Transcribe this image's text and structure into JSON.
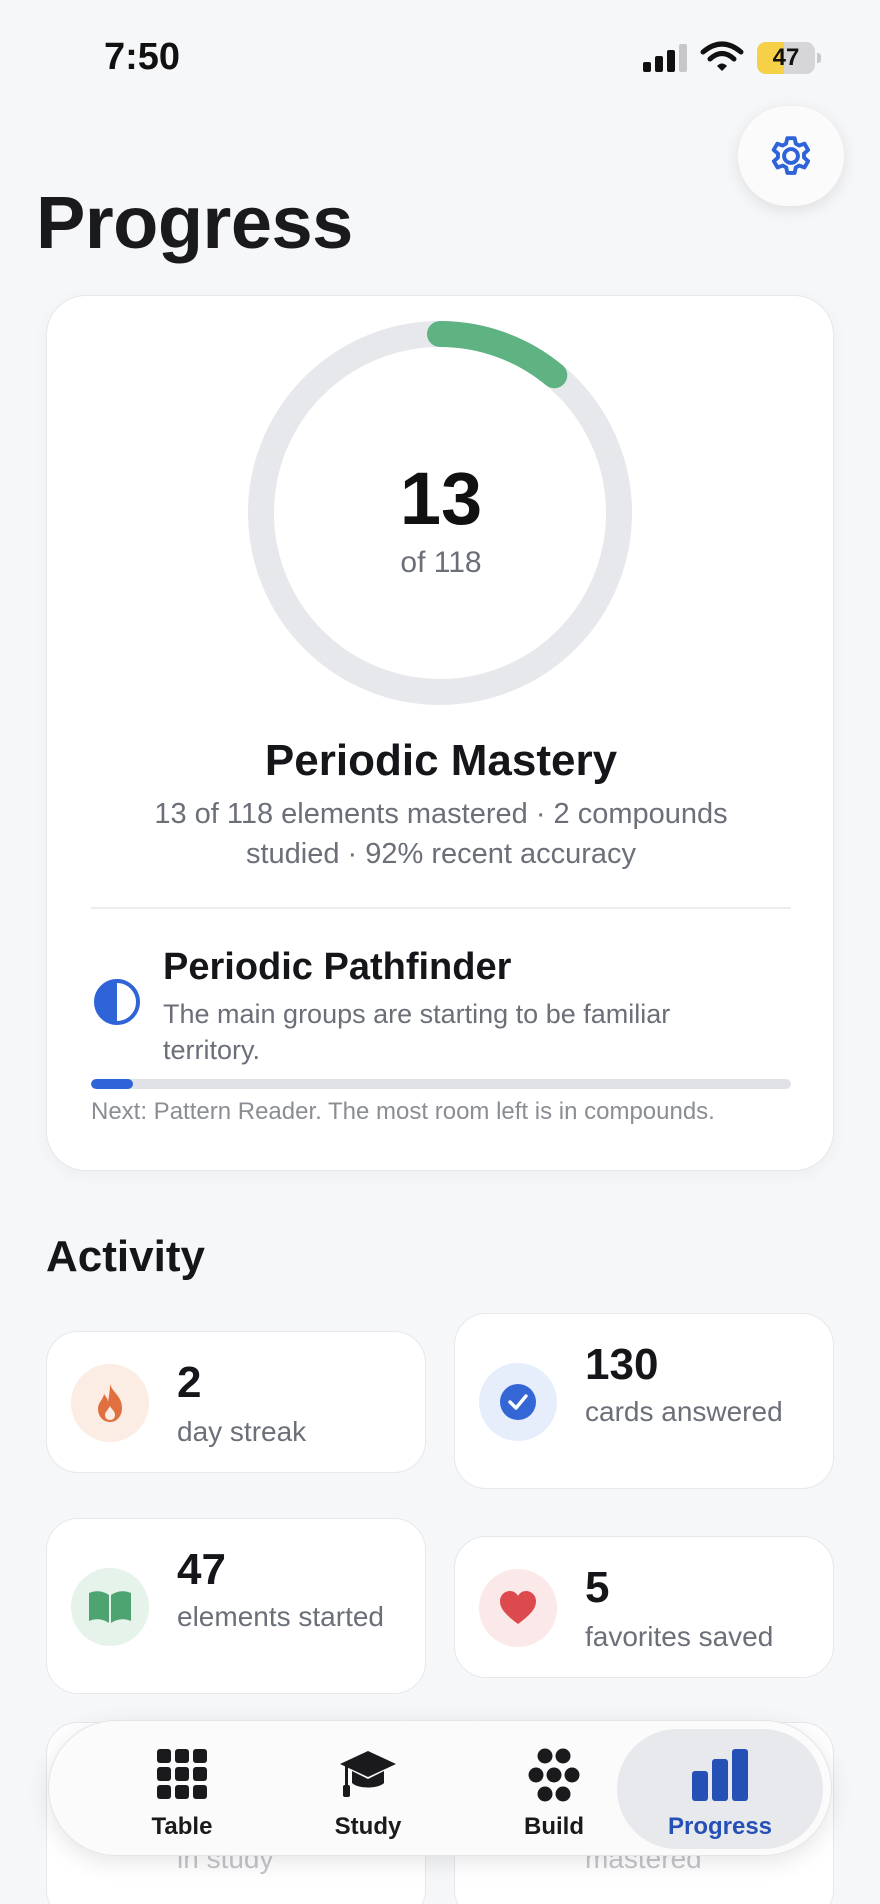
{
  "status_bar": {
    "time": "7:50",
    "battery": "47",
    "battery_level": 0.47
  },
  "header": {
    "title": "Progress"
  },
  "mastery": {
    "value": "13",
    "total_label": "of 118",
    "mastered": 13,
    "total": 118,
    "title": "Periodic Mastery",
    "stats": "13 of 118 elements mastered · 2 compounds studied · 92% recent accuracy",
    "progress_color": "#5fb383"
  },
  "rank": {
    "title": "Periodic Pathfinder",
    "description": "The main groups are starting to be familiar territory.",
    "progress": 0.06,
    "next": "Next: Pattern Reader. The most room left is in compounds.",
    "icon": "half-circle-icon"
  },
  "activity": {
    "title": "Activity",
    "cards": [
      {
        "value": "2",
        "label": "day streak",
        "icon": "flame-icon",
        "color": "#e0703f"
      },
      {
        "value": "130",
        "label": "cards answered",
        "icon": "checkmark-icon",
        "color": "#3566d6"
      },
      {
        "value": "47",
        "label": "elements started",
        "icon": "book-icon",
        "color": "#4ea471"
      },
      {
        "value": "5",
        "label": "favorites saved",
        "icon": "heart-icon",
        "color": "#dc4a4d"
      },
      {
        "value": "",
        "label": "in study",
        "icon": "",
        "color": ""
      },
      {
        "value": "",
        "label": "mastered",
        "icon": "",
        "color": ""
      }
    ]
  },
  "tabs": [
    {
      "label": "Table",
      "icon": "grid-icon",
      "active": false
    },
    {
      "label": "Study",
      "icon": "graduation-cap-icon",
      "active": false
    },
    {
      "label": "Build",
      "icon": "atoms-icon",
      "active": false
    },
    {
      "label": "Progress",
      "icon": "bar-chart-icon",
      "active": true
    }
  ],
  "colors": {
    "accent": "#2f63d8",
    "background": "#f6f7f9"
  }
}
